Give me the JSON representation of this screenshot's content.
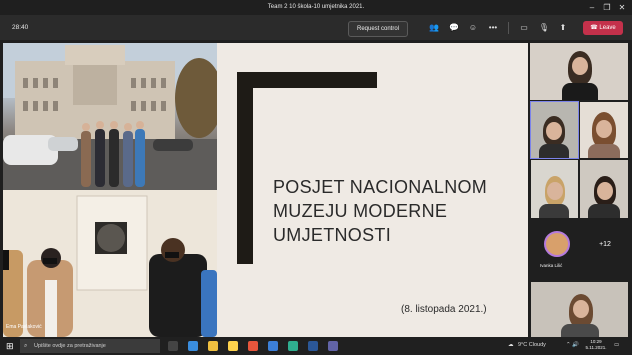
{
  "window": {
    "title": "Team 2 10 škola-10 umjetnika 2021.",
    "controls": [
      "minimize",
      "restore",
      "close"
    ]
  },
  "meeting": {
    "timer": "28:40",
    "request_control_label": "Request control",
    "leave_label": "Leave",
    "toolbar_icons": [
      "people-icon",
      "chat-icon",
      "reactions-icon",
      "more-icon",
      "camera-icon",
      "mic-off-icon",
      "share-icon",
      "phone-icon"
    ]
  },
  "stage": {
    "slide_title": "POSJET NACIONALNOM MUZEJU MODERNE UMJETNOSTI",
    "slide_date": "(8. listopada 2021.)",
    "presenter_name": "Ema Pavlaković",
    "slide_bg": "#efeae4",
    "bracket_color": "#1e1b16"
  },
  "participants": {
    "overflow_count": "+12",
    "avatar_name": "Ivanka Lilić"
  },
  "taskbar": {
    "search_placeholder": "Upišite ovdje za pretraživanje",
    "weather": "9°C Cloudy",
    "time": "10:29",
    "date": "5.11.2021.",
    "accent_leave": "#c4314b"
  }
}
